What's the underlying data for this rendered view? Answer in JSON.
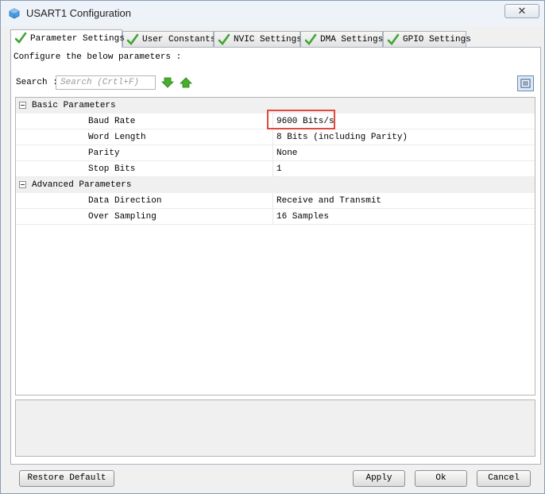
{
  "window": {
    "title": "USART1 Configuration",
    "close_label": "✕"
  },
  "tabs": [
    {
      "label": "Parameter Settings",
      "active": true
    },
    {
      "label": "User Constants",
      "active": false
    },
    {
      "label": "NVIC Settings",
      "active": false
    },
    {
      "label": "DMA Settings",
      "active": false
    },
    {
      "label": "GPIO Settings",
      "active": false
    }
  ],
  "panel": {
    "configure_label": "Configure the below parameters :",
    "search_label": "Search :",
    "search_placeholder": "Search (Crtl+F)"
  },
  "groups": [
    {
      "name": "Basic Parameters",
      "params": [
        {
          "name": "Baud Rate",
          "value": "9600 Bits/s"
        },
        {
          "name": "Word Length",
          "value": "8 Bits (including Parity)"
        },
        {
          "name": "Parity",
          "value": "None"
        },
        {
          "name": "Stop Bits",
          "value": "1"
        }
      ]
    },
    {
      "name": "Advanced Parameters",
      "params": [
        {
          "name": "Data Direction",
          "value": "Receive and Transmit"
        },
        {
          "name": "Over Sampling",
          "value": "16 Samples"
        }
      ]
    }
  ],
  "buttons": {
    "restore_default": "Restore Default",
    "apply": "Apply",
    "ok": "Ok",
    "cancel": "Cancel"
  },
  "colors": {
    "highlight": "#e04a3c",
    "check_green": "#3fa535",
    "arrow_green": "#47b02a"
  }
}
